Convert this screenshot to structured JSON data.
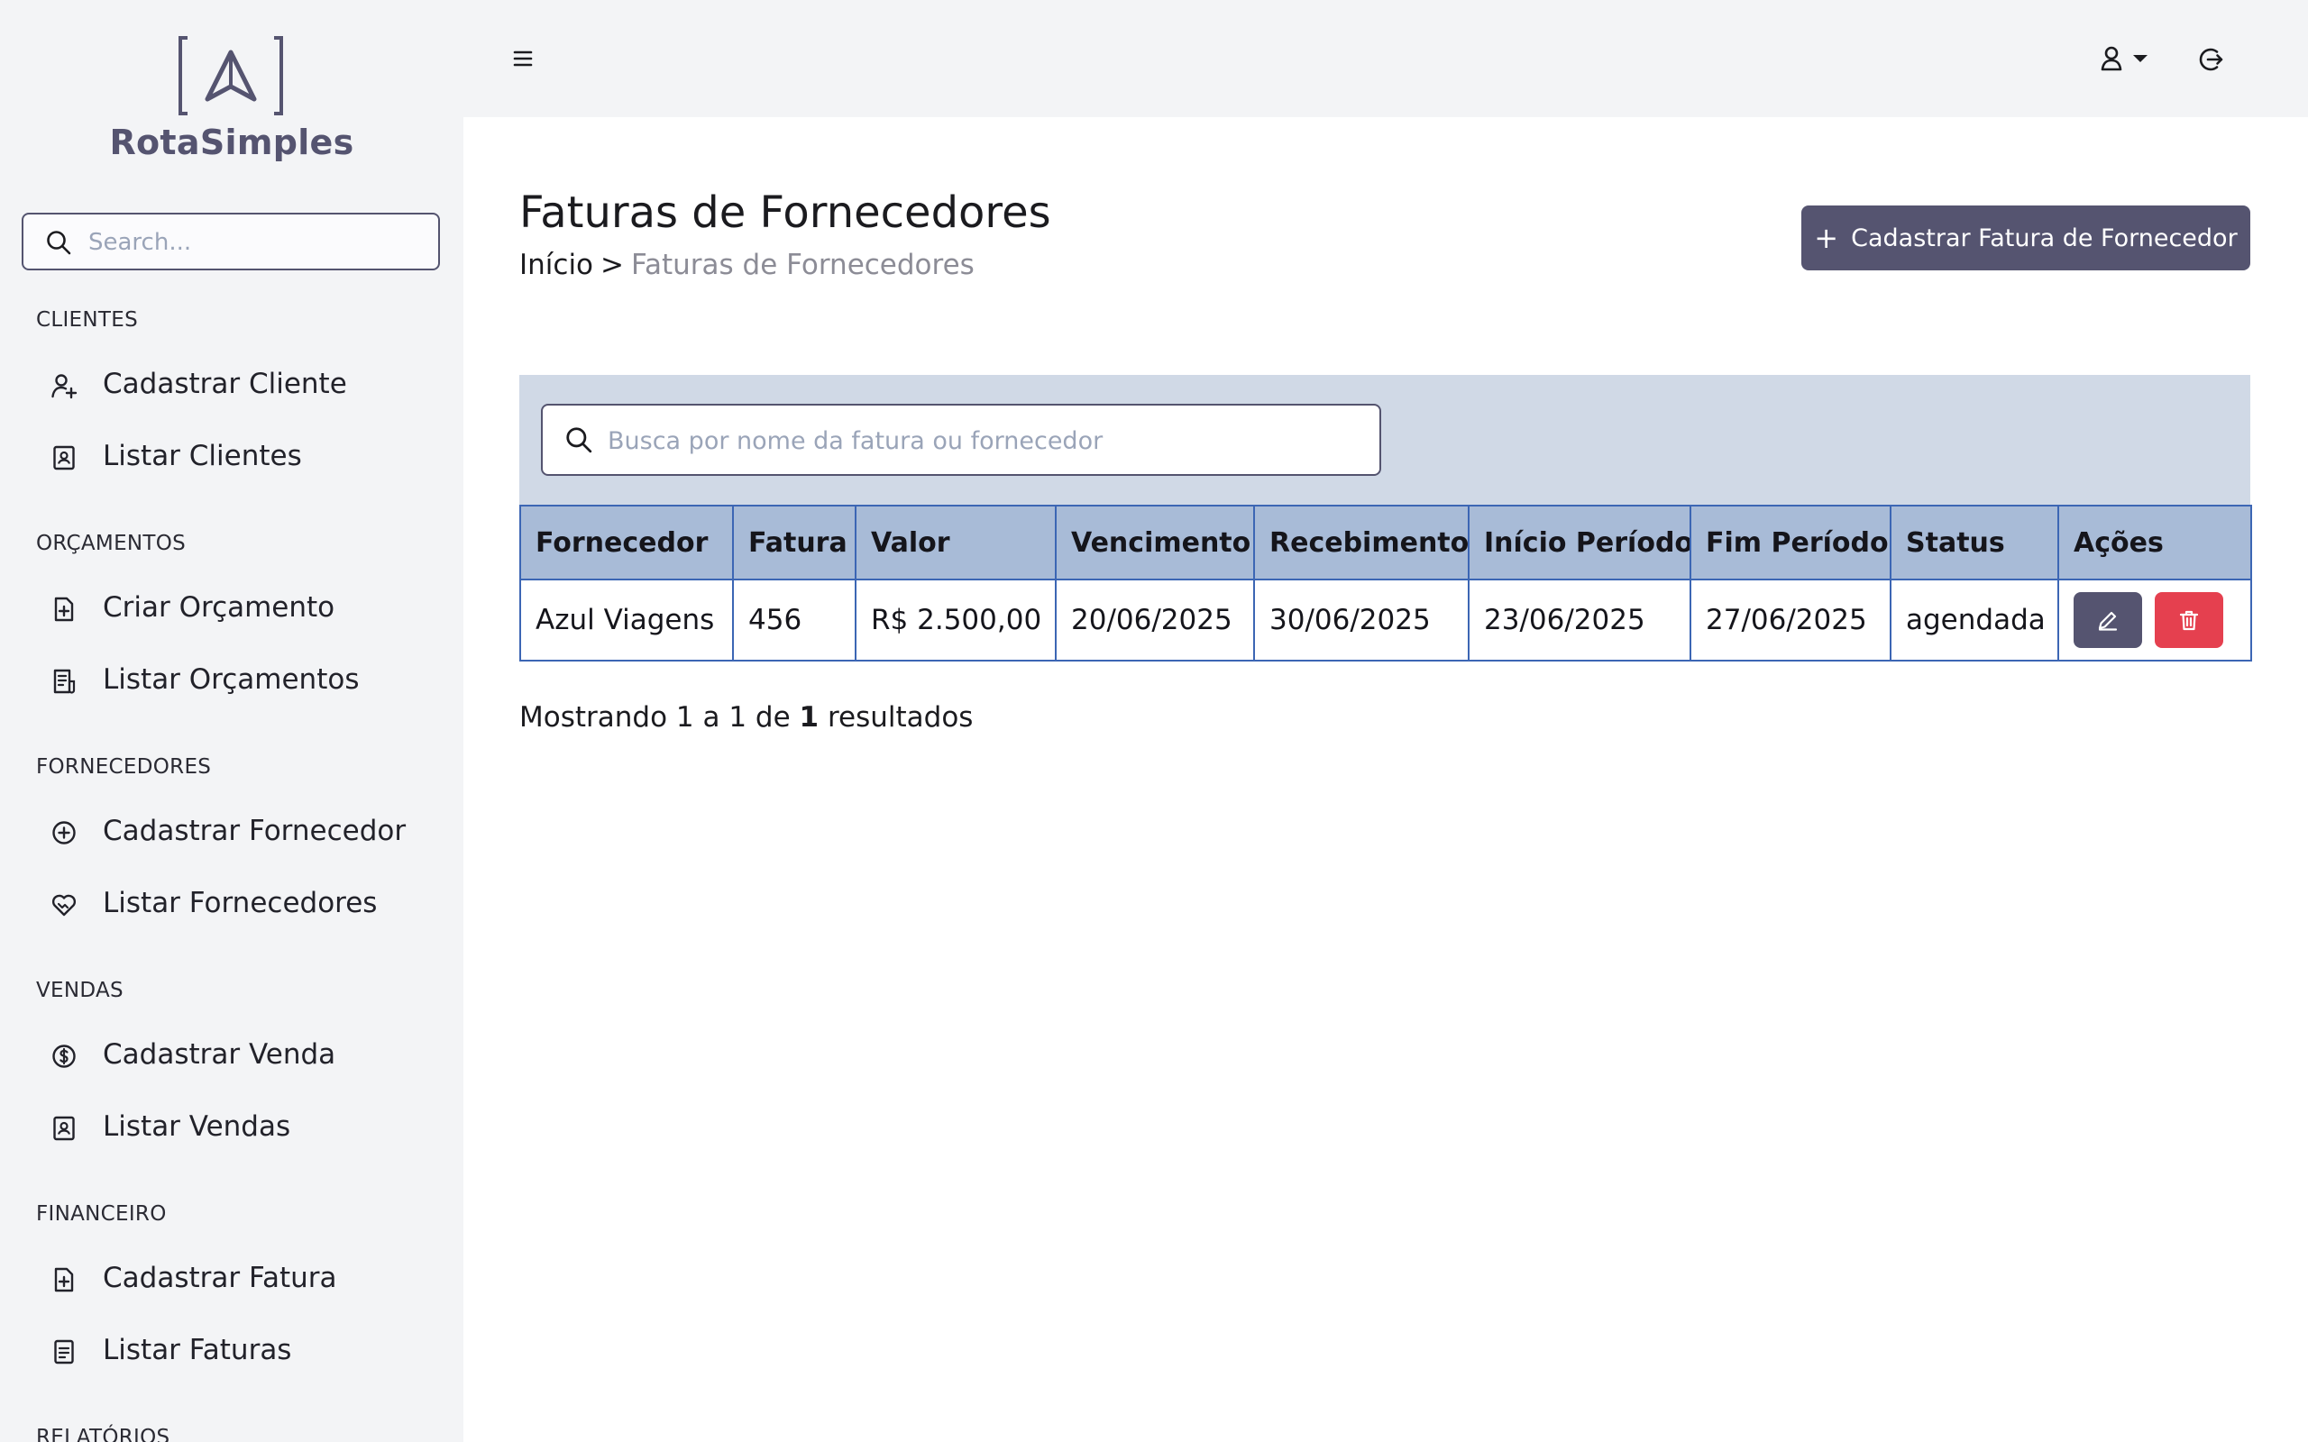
{
  "app": {
    "brand": "RotaSimples"
  },
  "sidebar": {
    "search_placeholder": "Search...",
    "sections": [
      {
        "title": "CLIENTES",
        "items": [
          {
            "label": "Cadastrar Cliente",
            "icon": "user-plus-icon"
          },
          {
            "label": "Listar Clientes",
            "icon": "contact-book-icon"
          }
        ]
      },
      {
        "title": "ORÇAMENTOS",
        "items": [
          {
            "label": "Criar Orçamento",
            "icon": "file-plus-icon"
          },
          {
            "label": "Listar Orçamentos",
            "icon": "file-list-icon"
          }
        ]
      },
      {
        "title": "FORNECEDORES",
        "items": [
          {
            "label": "Cadastrar Fornecedor",
            "icon": "circle-plus-icon"
          },
          {
            "label": "Listar Fornecedores",
            "icon": "handshake-heart-icon"
          }
        ]
      },
      {
        "title": "VENDAS",
        "items": [
          {
            "label": "Cadastrar Venda",
            "icon": "dollar-circle-icon"
          },
          {
            "label": "Listar Vendas",
            "icon": "contact-book-icon"
          }
        ]
      },
      {
        "title": "FINANCEIRO",
        "items": [
          {
            "label": "Cadastrar Fatura",
            "icon": "file-plus-icon"
          },
          {
            "label": "Listar Faturas",
            "icon": "document-lines-icon"
          }
        ]
      },
      {
        "title": "RELATÓRIOS",
        "items": []
      }
    ]
  },
  "topbar": {
    "icons": [
      "hamburger-menu-icon",
      "user-icon",
      "caret-down-icon",
      "logout-icon"
    ]
  },
  "page": {
    "title": "Faturas de Fornecedores",
    "breadcrumb": {
      "home": "Início",
      "separator": ">",
      "current": "Faturas de Fornecedores"
    },
    "add_button": {
      "icon": "plus-icon",
      "plus": "+",
      "label": "Cadastrar Fatura de Fornecedor"
    }
  },
  "table": {
    "search_placeholder": "Busca por nome da fatura ou fornecedor",
    "columns": [
      "Fornecedor",
      "Fatura",
      "Valor",
      "Vencimento",
      "Recebimento",
      "Início Período",
      "Fim Período",
      "Status",
      "Ações"
    ],
    "rows": [
      {
        "fornecedor": "Azul Viagens",
        "fatura": "456",
        "valor": "R$ 2.500,00",
        "vencimento": "20/06/2025",
        "recebimento": "30/06/2025",
        "inicio_periodo": "23/06/2025",
        "fim_periodo": "27/06/2025",
        "status": "agendada"
      }
    ],
    "action_icons": [
      "pencil-icon",
      "trash-icon"
    ]
  },
  "results": {
    "prefix": "Mostrando 1 a 1 de",
    "total": "1",
    "suffix": "resultados"
  },
  "colors": {
    "sidebar_bg": "#f3f4f6",
    "primary": "#555470",
    "danger": "#e5404f",
    "table_header_bg": "#a8bbd7",
    "table_panel_bg": "#d0d9e6",
    "table_border": "#3c66b4"
  }
}
